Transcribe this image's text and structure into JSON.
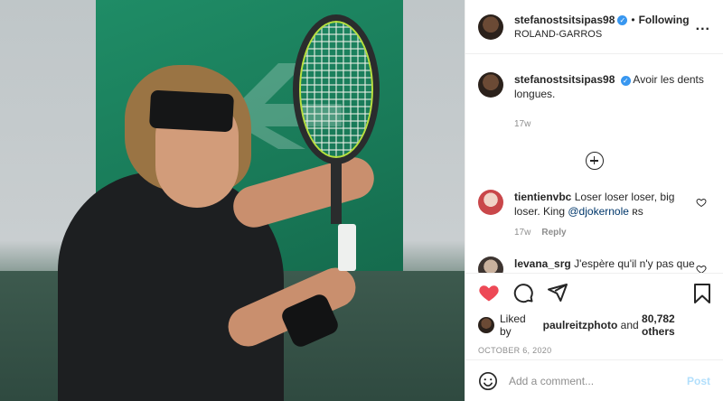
{
  "header": {
    "username": "stefanostsitsipas98",
    "dot": "•",
    "following": "Following",
    "location": "ROLAND-GARROS",
    "more": "..."
  },
  "caption": {
    "username": "stefanostsitsipas98",
    "text": "Avoir les dents longues.",
    "time": "17w"
  },
  "comments": [
    {
      "username": "tientienvbc",
      "text_before": "Loser loser loser, big loser. King ",
      "mention": "@djokernole",
      "text_after": " ʀs",
      "time": "17w",
      "reply": "Reply"
    },
    {
      "username": "levana_srg",
      "text": "J'espère qu'il n'y pas que les dents qui sont longues ..",
      "time": "",
      "reply": ""
    }
  ],
  "likes": {
    "prefix": "Liked by",
    "user": "paulreitzphoto",
    "middle": "and",
    "count": "80,782 others"
  },
  "date": "OCTOBER 6, 2020",
  "add_comment": {
    "placeholder": "Add a comment...",
    "post_label": "Post"
  },
  "colors": {
    "liked_heart": "#ed4956",
    "verified": "#3897f0",
    "link": "#00376b",
    "post_disabled": "#b2dffc"
  }
}
